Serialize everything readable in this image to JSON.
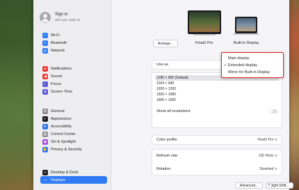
{
  "account": {
    "title": "Sign in",
    "subtitle": "with your Apple ID"
  },
  "sidebar": {
    "items": [
      {
        "label": "Wi-Fi",
        "icon": "wifi-icon",
        "color": "#2f7cf6",
        "glyph": "≈"
      },
      {
        "label": "Bluetooth",
        "icon": "bluetooth-icon",
        "color": "#2f7cf6",
        "glyph": "ᛒ"
      },
      {
        "label": "Network",
        "icon": "globe-icon",
        "color": "#2f7cf6",
        "glyph": "◎"
      },
      {
        "label": "Notifications",
        "icon": "bell-icon",
        "color": "#ef3b3b",
        "glyph": "●"
      },
      {
        "label": "Sound",
        "icon": "speaker-icon",
        "color": "#ef3b3b",
        "glyph": "◀"
      },
      {
        "label": "Focus",
        "icon": "moon-icon",
        "color": "#5b5bd6",
        "glyph": "☾"
      },
      {
        "label": "Screen Time",
        "icon": "hourglass-icon",
        "color": "#5b5bd6",
        "glyph": "⧗"
      },
      {
        "label": "General",
        "icon": "gear-icon",
        "color": "#8e8e93",
        "glyph": "⚙"
      },
      {
        "label": "Appearance",
        "icon": "appearance-icon",
        "color": "#1d1d1f",
        "glyph": "◐"
      },
      {
        "label": "Accessibility",
        "icon": "accessibility-icon",
        "color": "#2f7cf6",
        "glyph": "♿"
      },
      {
        "label": "Control Center",
        "icon": "control-center-icon",
        "color": "#8e8e93",
        "glyph": "▤"
      },
      {
        "label": "Siri & Spotlight",
        "icon": "siri-icon",
        "color": "#a74ee0",
        "glyph": "◉"
      },
      {
        "label": "Privacy & Security",
        "icon": "hand-icon",
        "color": "#2f7cf6",
        "glyph": "✋"
      },
      {
        "label": "Desktop & Dock",
        "icon": "dock-icon",
        "color": "#1d1d1f",
        "glyph": "▭"
      },
      {
        "label": "Displays",
        "icon": "sun-icon",
        "color": "#2f7cf6",
        "glyph": "☼"
      }
    ]
  },
  "displays": {
    "arrange_label": "Arrange...",
    "primary_label": "Float2 Pro",
    "secondary_label": "Built-in Display"
  },
  "use_as": {
    "label": "Use as"
  },
  "resolutions": [
    {
      "label": "1280 × 800 (Default)",
      "selected": true
    },
    {
      "label": "1024 × 640",
      "selected": false
    },
    {
      "label": "1920 × 1200",
      "selected": false
    },
    {
      "label": "1920 × 1080",
      "selected": false
    },
    {
      "label": "1600 × 1000",
      "selected": false
    }
  ],
  "show_all": {
    "label": "Show all resolutions",
    "enabled": false
  },
  "settings": {
    "color_profile_label": "Color profile",
    "color_profile_value": "Float2 Pro ≎",
    "refresh_label": "Refresh rate",
    "refresh_value": "120 Hertz ≎",
    "rotation_label": "Rotation",
    "rotation_value": "Standard ≎"
  },
  "menu": {
    "items": [
      {
        "label": "Main display",
        "checked": false
      },
      {
        "label": "Extended display",
        "checked": true
      },
      {
        "label": "Mirror for Built-in Display",
        "checked": false
      }
    ],
    "border_color": "#e02020"
  },
  "bottom": {
    "advanced_label": "Advanced...",
    "night_shift_label": "Night Shift...",
    "help_label": "?"
  }
}
